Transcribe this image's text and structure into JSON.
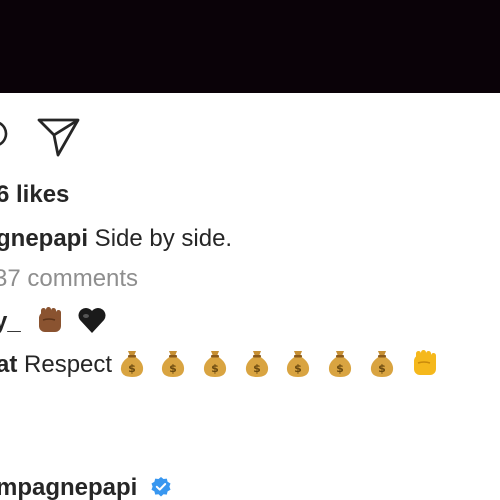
{
  "post": {
    "likes_text": "6 likes",
    "caption_user": "gnepapi",
    "caption_text": " Side by side.",
    "view_comments_text": "37 comments",
    "comments": [
      {
        "user": "y_",
        "text": ""
      },
      {
        "user": "at",
        "text": " Respect "
      }
    ],
    "author_name": "mpagnepapi"
  },
  "icons": {
    "comment": "comment-bubble-icon",
    "share": "paper-plane-icon",
    "verified": "verified-badge-icon"
  },
  "colors": {
    "media_background": "#0a0208",
    "text": "#262626",
    "muted_text": "#8e8e8e",
    "verified_blue": "#3897f0"
  }
}
